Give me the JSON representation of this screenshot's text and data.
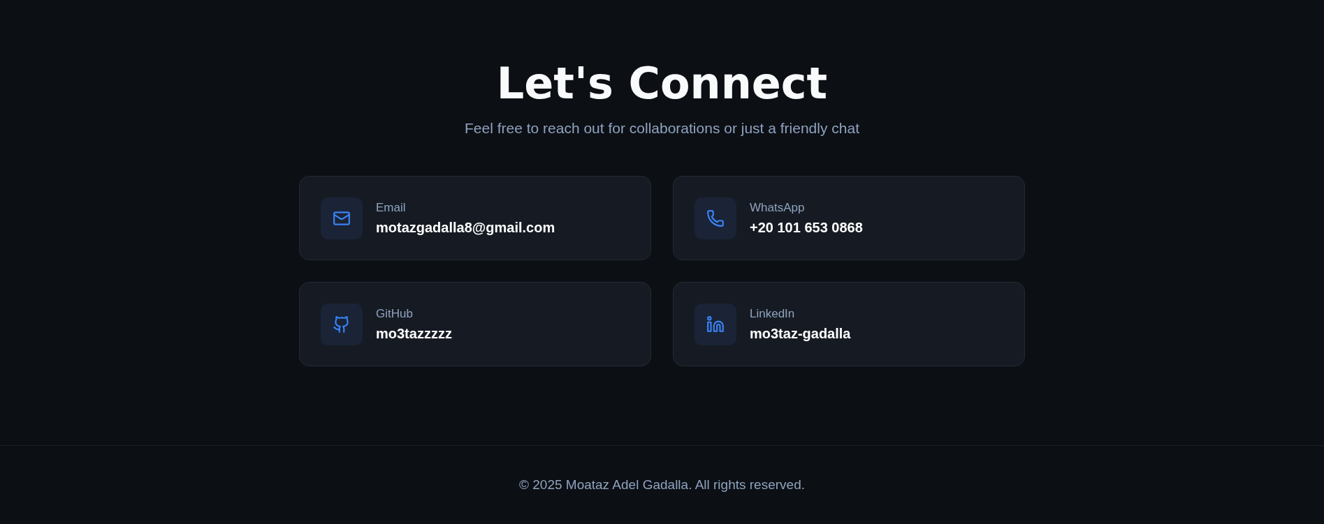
{
  "header": {
    "title": "Let's Connect",
    "subtitle": "Feel free to reach out for collaborations or just a friendly chat"
  },
  "contacts": [
    {
      "kind": "email",
      "label": "Email",
      "value": "motazgadalla8@gmail.com"
    },
    {
      "kind": "whatsapp",
      "label": "WhatsApp",
      "value": "+20 101 653 0868"
    },
    {
      "kind": "github",
      "label": "GitHub",
      "value": "mo3tazzzzz"
    },
    {
      "kind": "linkedin",
      "label": "LinkedIn",
      "value": "mo3taz-gadalla"
    }
  ],
  "footer": {
    "text": "© 2025 Moataz Adel Gadalla. All rights reserved."
  }
}
